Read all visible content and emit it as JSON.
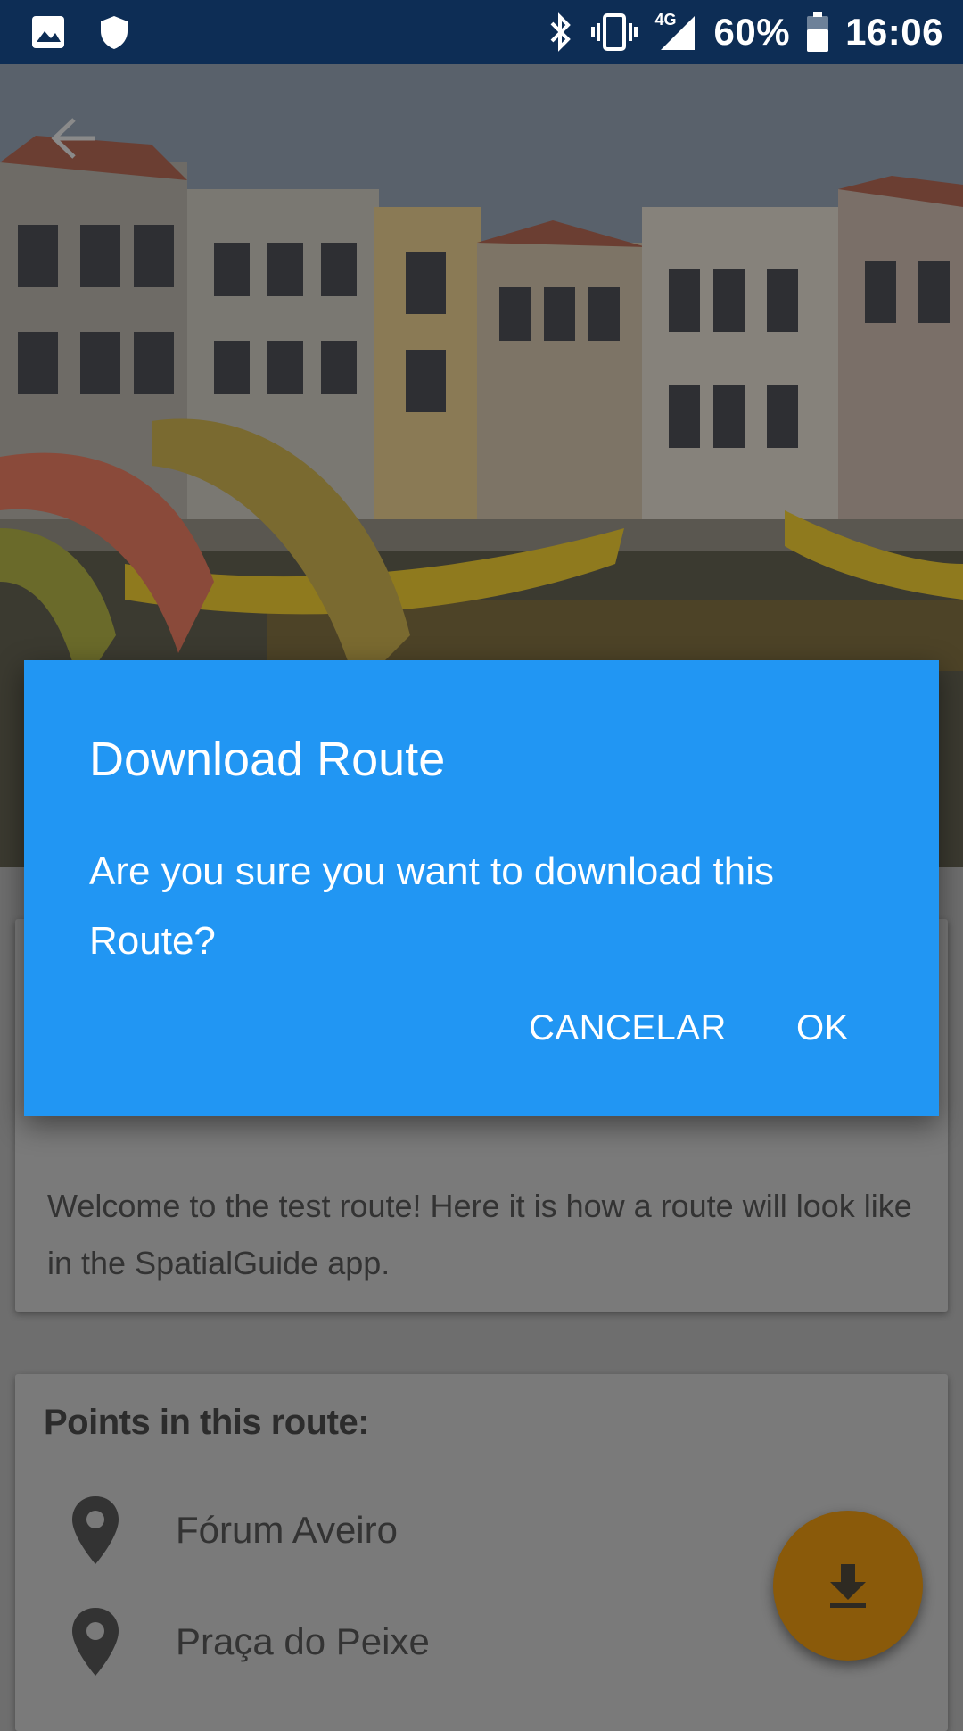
{
  "status_bar": {
    "network": "4G",
    "battery": "60%",
    "time": "16:06",
    "icons": [
      "image-icon",
      "shield-icon",
      "bluetooth-icon",
      "vibrate-icon",
      "signal-icon",
      "battery-icon"
    ]
  },
  "hero": {
    "back_icon": "arrow-back-icon"
  },
  "description": {
    "text": "Welcome to the test route! Here it is how a route will look like in the SpatialGuide app."
  },
  "points": {
    "title": "Points in this route:",
    "items": [
      {
        "label": "Fórum Aveiro",
        "icon": "location-pin-icon"
      },
      {
        "label": "Praça do Peixe",
        "icon": "location-pin-icon"
      }
    ]
  },
  "fab": {
    "icon": "download-icon",
    "color": "#8a5a0a"
  },
  "dialog": {
    "title": "Download Route",
    "message": "Are you sure you want to download this Route?",
    "cancel_label": "CANCELAR",
    "ok_label": "OK",
    "background": "#2196f3"
  }
}
